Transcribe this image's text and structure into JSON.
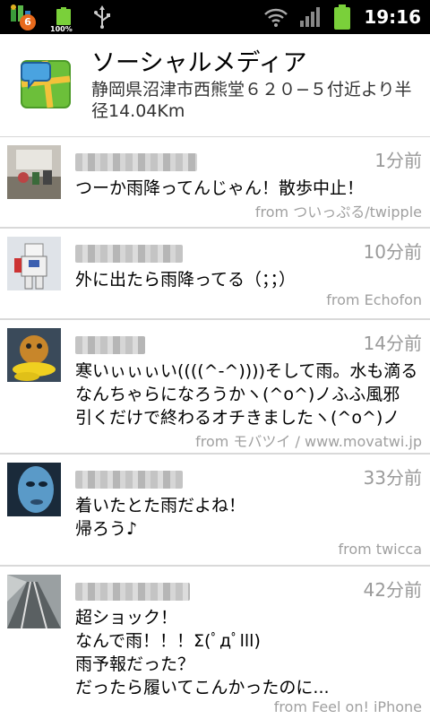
{
  "status_bar": {
    "notification_count": "6",
    "battery_percent": "100%",
    "time": "19:16"
  },
  "header": {
    "title": "ソーシャルメディア",
    "subtitle": "静岡県沼津市西熊堂６２０−５付近より半径14.04Km"
  },
  "tweets": [
    {
      "time": "1分前",
      "text": "つーか雨降ってんじゃん！散歩中止！",
      "via": "from ついっぷる/twipple"
    },
    {
      "time": "10分前",
      "text": "外に出たら雨降ってる（；；）",
      "via": "from Echofon"
    },
    {
      "time": "14分前",
      "text": "寒いぃぃぃい((((^-^))))そして雨。水も滴る\nなんちゃらになろうかヽ(^o^)ノふふ風邪\n引くだけで終わるオチきましたヽ(^o^)ノ",
      "via": "from モバツイ / www.movatwi.jp"
    },
    {
      "time": "33分前",
      "text": "着いたとた雨だよね！\n帰ろう♪",
      "via": "from twicca"
    },
    {
      "time": "42分前",
      "text": "超ショック！\nなんで雨！！！Σ(ﾟдﾟlll)\n雨予報だった？\nだったら履いてこんかったのに...",
      "via": "from Feel on! iPhone"
    }
  ]
}
